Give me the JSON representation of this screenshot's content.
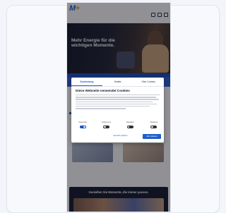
{
  "header": {
    "logo_text": "M",
    "logo_accent": "+",
    "top_links": [
      "",
      "",
      "",
      ""
    ],
    "nav_items": [
      "",
      "",
      "",
      "",
      "",
      "",
      ""
    ],
    "icons": [
      "search-icon",
      "user-icon",
      "menu-icon"
    ]
  },
  "hero": {
    "kicker": "",
    "title": "Mehr Energie für die wichtigen Momente."
  },
  "tiles": {
    "captions": [
      "",
      ""
    ]
  },
  "promo": {
    "title": "Genießen Sie Momente, die immer passen."
  },
  "cookie_dialog": {
    "tabs": [
      "Zustimmung",
      "Details",
      "Über Cookies"
    ],
    "title": "Diese Webseite verwendet Cookies",
    "toggle_labels": [
      "Notwendig",
      "Präferenzen",
      "Statistiken",
      "Marketing"
    ],
    "toggle_states": [
      true,
      false,
      false,
      false
    ],
    "secondary_button": "Auswahl erlauben",
    "primary_button": "Alle zulassen"
  },
  "colors": {
    "brand_blue": "#1f5fcf",
    "brand_orange": "#f39a1b",
    "hero_dark": "#15192a"
  }
}
